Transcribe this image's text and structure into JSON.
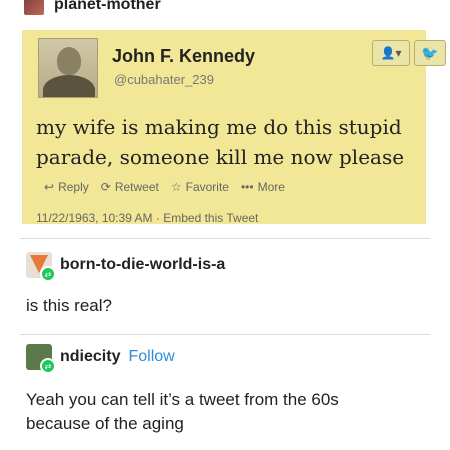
{
  "op": {
    "username": "planet-mother"
  },
  "tweet": {
    "display_name": "John F. Kennedy",
    "handle": "@cubahater_239",
    "follow_icon": "person-icon",
    "text": "my wife is making me do this stupid parade, someone kill me now please",
    "actions": [
      {
        "icon": "reply-icon",
        "label": "Reply"
      },
      {
        "icon": "retweet-icon",
        "label": "Retweet"
      },
      {
        "icon": "star-icon",
        "label": "Favorite"
      },
      {
        "icon": "more-icon",
        "label": "More"
      }
    ],
    "timestamp": "11/22/1963, 10:39 AM",
    "embed": "Embed this Tweet",
    "bg_color": "#f2e796"
  },
  "reply1": {
    "username": "born-to-die-world-is-a",
    "text": "is this real?"
  },
  "reply2": {
    "username": "ndiecity",
    "follow_label": "Follow",
    "text1": "Yeah you can tell it’s a tweet from the 60s",
    "text2": "because of the aging"
  }
}
